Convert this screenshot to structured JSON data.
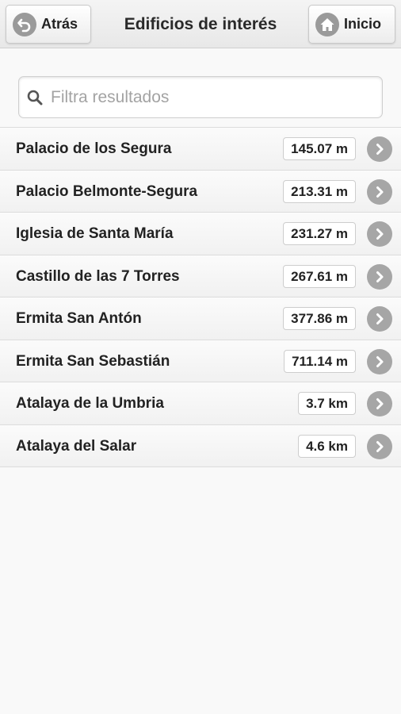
{
  "header": {
    "back_label": "Atrás",
    "title": "Edificios de interés",
    "home_label": "Inicio"
  },
  "search": {
    "placeholder": "Filtra resultados",
    "value": ""
  },
  "items": [
    {
      "name": "Palacio de los Segura",
      "distance": "145.07 m"
    },
    {
      "name": "Palacio Belmonte-Segura",
      "distance": "213.31 m"
    },
    {
      "name": "Iglesia de Santa María",
      "distance": "231.27 m"
    },
    {
      "name": "Castillo de las 7 Torres",
      "distance": "267.61 m"
    },
    {
      "name": "Ermita San Antón",
      "distance": "377.86 m"
    },
    {
      "name": "Ermita San Sebastián",
      "distance": "711.14 m"
    },
    {
      "name": "Atalaya de la Umbria",
      "distance": "3.7 km"
    },
    {
      "name": "Atalaya del Salar",
      "distance": "4.6 km"
    }
  ],
  "icons": {
    "back": "back-arrow-icon",
    "home": "home-icon",
    "search": "search-icon",
    "row_arrow": "chevron-right-icon"
  },
  "colors": {
    "icon_gray": "#9a9a9a",
    "background": "#f9f9f9"
  }
}
